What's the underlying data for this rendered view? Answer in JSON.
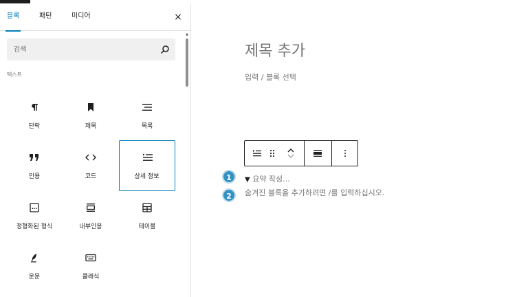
{
  "tabs": [
    {
      "label": "블록",
      "active": true
    },
    {
      "label": "패턴",
      "active": false
    },
    {
      "label": "미디어",
      "active": false
    }
  ],
  "close_symbol": "×",
  "search": {
    "placeholder": "검색",
    "icon": "search-icon"
  },
  "category": "텍스트",
  "blocks": [
    {
      "label": "단락",
      "icon": "pilcrow-icon"
    },
    {
      "label": "제목",
      "icon": "bookmark-icon"
    },
    {
      "label": "목록",
      "icon": "list-icon"
    },
    {
      "label": "인용",
      "icon": "quote-icon"
    },
    {
      "label": "코드",
      "icon": "code-icon"
    },
    {
      "label": "상세 정보",
      "icon": "details-icon",
      "selected": true
    },
    {
      "label": "정형화된 형식",
      "icon": "preformatted-icon"
    },
    {
      "label": "내부인용",
      "icon": "pullquote-icon"
    },
    {
      "label": "테이블",
      "icon": "table-icon"
    },
    {
      "label": "운문",
      "icon": "verse-icon"
    },
    {
      "label": "클래식",
      "icon": "keyboard-icon"
    }
  ],
  "editor": {
    "title_placeholder": "제목 추가",
    "subhint": "입력 / 블록 선택",
    "summary_placeholder": "요약 작성...",
    "summary_triangle": "▼",
    "hidden_hint": "숨겨진 블록을 추가하려면 /를 입력하십시오.",
    "badges": [
      "1",
      "2"
    ]
  },
  "colors": {
    "accent": "#007cba",
    "badge": "#3391c4",
    "placeholder": "#757575"
  }
}
